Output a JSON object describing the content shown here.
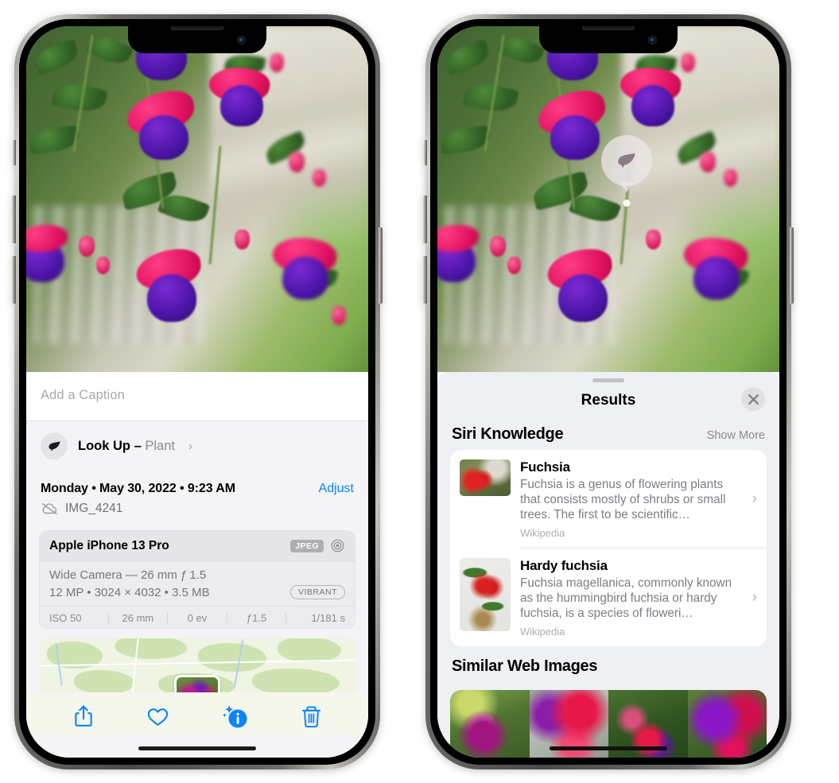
{
  "left_phone": {
    "photo": {
      "alt": "fuchsia-flowers-photo"
    },
    "caption_placeholder": "Add a Caption",
    "lookup": {
      "label": "Look Up – ",
      "subject": "Plant",
      "chevron": "›",
      "icon": "leaf-icon"
    },
    "metadata": {
      "date": "Monday • May 30, 2022 • 9:23 AM",
      "adjust_label": "Adjust",
      "filename": "IMG_4241",
      "cloud_icon": "cloud-slash-icon"
    },
    "camera_card": {
      "device": "Apple iPhone 13 Pro",
      "format_tag": "JPEG",
      "aperture_icon": "aperture-icon",
      "lens_line": "Wide Camera — 26 mm ƒ 1.5",
      "size_line": "12 MP • 3024 × 4032 • 3.5 MB",
      "style_tag": "VIBRANT",
      "exif": [
        "ISO 50",
        "26 mm",
        "0 ev",
        "ƒ1.5",
        "1/181 s"
      ]
    },
    "toolbar": [
      {
        "name": "share-button",
        "icon": "share-icon"
      },
      {
        "name": "favorite-button",
        "icon": "heart-icon"
      },
      {
        "name": "info-button",
        "icon": "info-sparkle-icon"
      },
      {
        "name": "delete-button",
        "icon": "trash-icon"
      }
    ],
    "accent_color": "#0a84ff"
  },
  "right_phone": {
    "lookup_bubble": {
      "icon": "leaf-icon"
    },
    "sheet": {
      "title": "Results",
      "close_icon": "close-icon",
      "sections": [
        {
          "title": "Siri Knowledge",
          "action": "Show More",
          "cards": [
            {
              "title": "Fuchsia",
              "description": "Fuchsia is a genus of flowering plants that consists mostly of shrubs or small trees. The first to be scientific…",
              "source": "Wikipedia",
              "thumb": "fuchsia-red-flowers-thumb"
            },
            {
              "title": "Hardy fuchsia",
              "description": "Fuchsia magellanica, commonly known as the hummingbird fuchsia or hardy fuchsia, is a species of floweri…",
              "source": "Wikipedia",
              "thumb": "hardy-fuchsia-specimen-thumb"
            }
          ]
        },
        {
          "title": "Similar Web Images",
          "images": [
            "fuchsia-web-image-1",
            "fuchsia-web-image-2",
            "fuchsia-web-image-3",
            "fuchsia-web-image-4"
          ]
        }
      ]
    }
  }
}
